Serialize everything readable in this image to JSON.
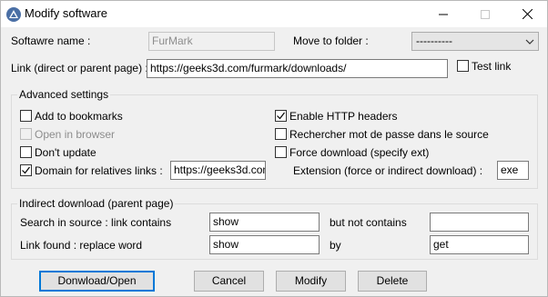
{
  "window": {
    "title": "Modify software"
  },
  "form": {
    "software_name_label": "Softawre name :",
    "software_name_value": "FurMark",
    "move_to_folder_label": "Move to folder :",
    "folder_value": "----------",
    "link_label": "Link (direct or parent page) :",
    "link_value": "https://geeks3d.com/furmark/downloads/",
    "test_link_label": "Test link"
  },
  "advanced": {
    "title": "Advanced settings",
    "add_to_bookmarks": "Add to bookmarks",
    "open_in_browser": "Open in browser",
    "dont_update": "Don't update",
    "domain_for_links": "Domain for relatives links :",
    "domain_value": "https://geeks3d.com",
    "enable_http_headers": "Enable HTTP headers",
    "search_password": "Rechercher mot de passe dans le source",
    "force_download": "Force download (specify ext)",
    "extension_label": "Extension (force or indirect download) :",
    "extension_value": "exe"
  },
  "indirect": {
    "title": "Indirect download (parent page)",
    "search_label": "Search in source : link contains",
    "search_value": "show",
    "not_contains_label": "but not contains",
    "not_contains_value": "",
    "replace_label": "Link found : replace word",
    "replace_value": "show",
    "by_label": "by",
    "by_value": "get"
  },
  "buttons": {
    "download_open": "Donwload/Open",
    "cancel": "Cancel",
    "modify": "Modify",
    "delete": "Delete"
  },
  "checkbox_states": {
    "test_link": false,
    "add_to_bookmarks": false,
    "open_in_browser": false,
    "dont_update": false,
    "domain_for_links": true,
    "enable_http_headers": true,
    "search_password": false,
    "force_download": false
  }
}
